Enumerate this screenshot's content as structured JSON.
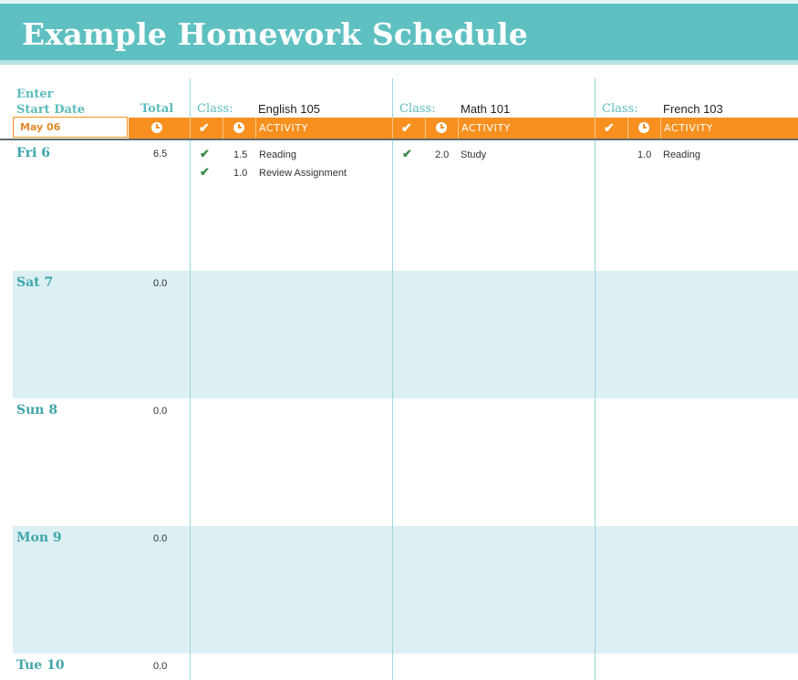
{
  "title": "Example Homework Schedule",
  "start_date": {
    "label_line1": "Enter",
    "label_line2": "Start Date",
    "value": "May 06"
  },
  "total_label": "Total",
  "classes": [
    {
      "label": "Class:",
      "name": "English 105",
      "activity_header": "ACTIVITY"
    },
    {
      "label": "Class:",
      "name": "Math 101",
      "activity_header": "ACTIVITY"
    },
    {
      "label": "Class:",
      "name": "French 103",
      "activity_header": "ACTIVITY"
    }
  ],
  "icons": {
    "done": "check-icon",
    "time": "clock-icon"
  },
  "days": [
    {
      "label": "Fri 6",
      "total": "6.5"
    },
    {
      "label": "Sat 7",
      "total": "0.0"
    },
    {
      "label": "Sun 8",
      "total": "0.0"
    },
    {
      "label": "Mon 9",
      "total": "0.0"
    },
    {
      "label": "Tue 10",
      "total": "0.0"
    }
  ],
  "entries": {
    "fri": {
      "english": [
        {
          "done": true,
          "hours": "1.5",
          "activity": "Reading"
        },
        {
          "done": true,
          "hours": "1.0",
          "activity": "Review Assignment"
        }
      ],
      "math": [
        {
          "done": true,
          "hours": "2.0",
          "activity": "Study"
        }
      ],
      "french": [
        {
          "done": false,
          "hours": "1.0",
          "activity": "Reading"
        }
      ]
    }
  },
  "colors": {
    "title_bg": "#5fc0c1",
    "header_bar": "#f7901e",
    "accent_text": "#5cbcbd",
    "alt_row": "#dcf0f3",
    "check_green": "#3a8a4a"
  }
}
